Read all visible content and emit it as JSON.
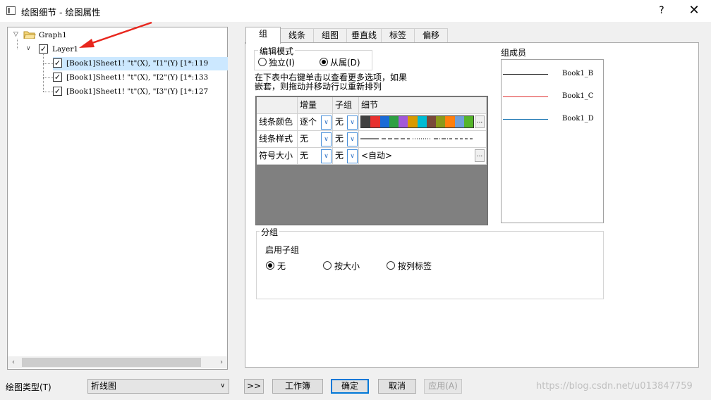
{
  "window": {
    "title": "绘图细节 - 绘图属性",
    "help_label": "?",
    "close_label": "✕"
  },
  "tree": {
    "graph": "Graph1",
    "layer": "Layer1",
    "items": [
      {
        "label": "[Book1]Sheet1! \"t\"(X), \"I1\"(Y) [1*:119",
        "checked": true,
        "selected": true
      },
      {
        "label": "[Book1]Sheet1! \"t\"(X), \"I2\"(Y) [1*:133",
        "checked": true,
        "selected": false
      },
      {
        "label": "[Book1]Sheet1! \"t\"(X), \"I3\"(Y) [1*:127",
        "checked": true,
        "selected": false
      }
    ],
    "scroll_left": "‹",
    "scroll_right": "›"
  },
  "tabs": [
    {
      "label": "组",
      "active": true
    },
    {
      "label": "线条",
      "active": false
    },
    {
      "label": "组图",
      "active": false
    },
    {
      "label": "垂直线",
      "active": false
    },
    {
      "label": "标签",
      "active": false
    },
    {
      "label": "偏移",
      "active": false
    }
  ],
  "edit_mode": {
    "title": "编辑模式",
    "independent": "独立(I)",
    "dependent": "从属(D)",
    "selected": "dependent"
  },
  "instruction": "在下表中右键单击以查看更多选项，如果嵌套，则拖动并移动行以重新排列",
  "grid": {
    "headers": [
      "增量",
      "子组",
      "细节"
    ],
    "rows": [
      {
        "name": "线条颜色",
        "increment": "逐个",
        "subgroup": "无",
        "detail": ""
      },
      {
        "name": "线条样式",
        "increment": "无",
        "subgroup": "无",
        "detail": ""
      },
      {
        "name": "符号大小",
        "increment": "无",
        "subgroup": "无",
        "detail": "<自动>"
      }
    ],
    "color_swatches": [
      "#404040",
      "#e8312f",
      "#1a6bd6",
      "#2ea043",
      "#a259d9",
      "#d99a00",
      "#00bcd4",
      "#7a4a3a",
      "#8b9a1a",
      "#ff7f0e",
      "#6f9fd8",
      "#55b52a"
    ],
    "dropdown_glyph": "∨",
    "ellipsis": "..."
  },
  "members": {
    "title": "组成员",
    "items": [
      {
        "name": "Book1_B",
        "color": "#202020"
      },
      {
        "name": "Book1_C",
        "color": "#e03030"
      },
      {
        "name": "Book1_D",
        "color": "#1f78b4"
      }
    ]
  },
  "grouping": {
    "title": "分组",
    "enable_sub": "启用子组",
    "options": [
      {
        "label": "无",
        "selected": true
      },
      {
        "label": "按大小",
        "selected": false
      },
      {
        "label": "按列标签",
        "selected": false
      }
    ]
  },
  "bottom": {
    "plot_type_label": "绘图类型(T)",
    "plot_type_value": "折线图",
    "expand": ">>",
    "workbook": "工作簿",
    "ok": "确定",
    "cancel": "取消",
    "apply": "应用(A)",
    "watermark": "https://blog.csdn.net/u013847759"
  }
}
